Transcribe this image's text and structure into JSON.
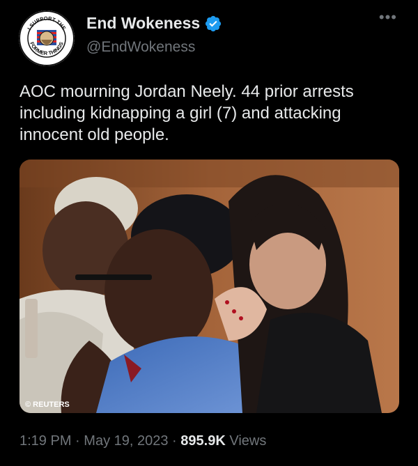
{
  "author": {
    "name": "End Wokeness",
    "handle": "@EndWokeness",
    "avatar_text_top": "I SUPPORT THE",
    "avatar_text_bottom": "FORMER THINGS"
  },
  "tweet": {
    "text": "AOC mourning Jordan Neely. 44 prior arrests including kidnapping a girl (7) and attacking innocent old people."
  },
  "media": {
    "credit": "REUTERS"
  },
  "meta": {
    "time": "1:19 PM",
    "date": "May 19, 2023",
    "views_count": "895.9K",
    "views_label": "Views",
    "separator": "·"
  },
  "icons": {
    "verified": "verified-badge-icon",
    "more": "more-options-icon"
  },
  "colors": {
    "background": "#000000",
    "primary_text": "#e7e9ea",
    "secondary_text": "#71767b",
    "verified_blue": "#1d9bf0"
  }
}
